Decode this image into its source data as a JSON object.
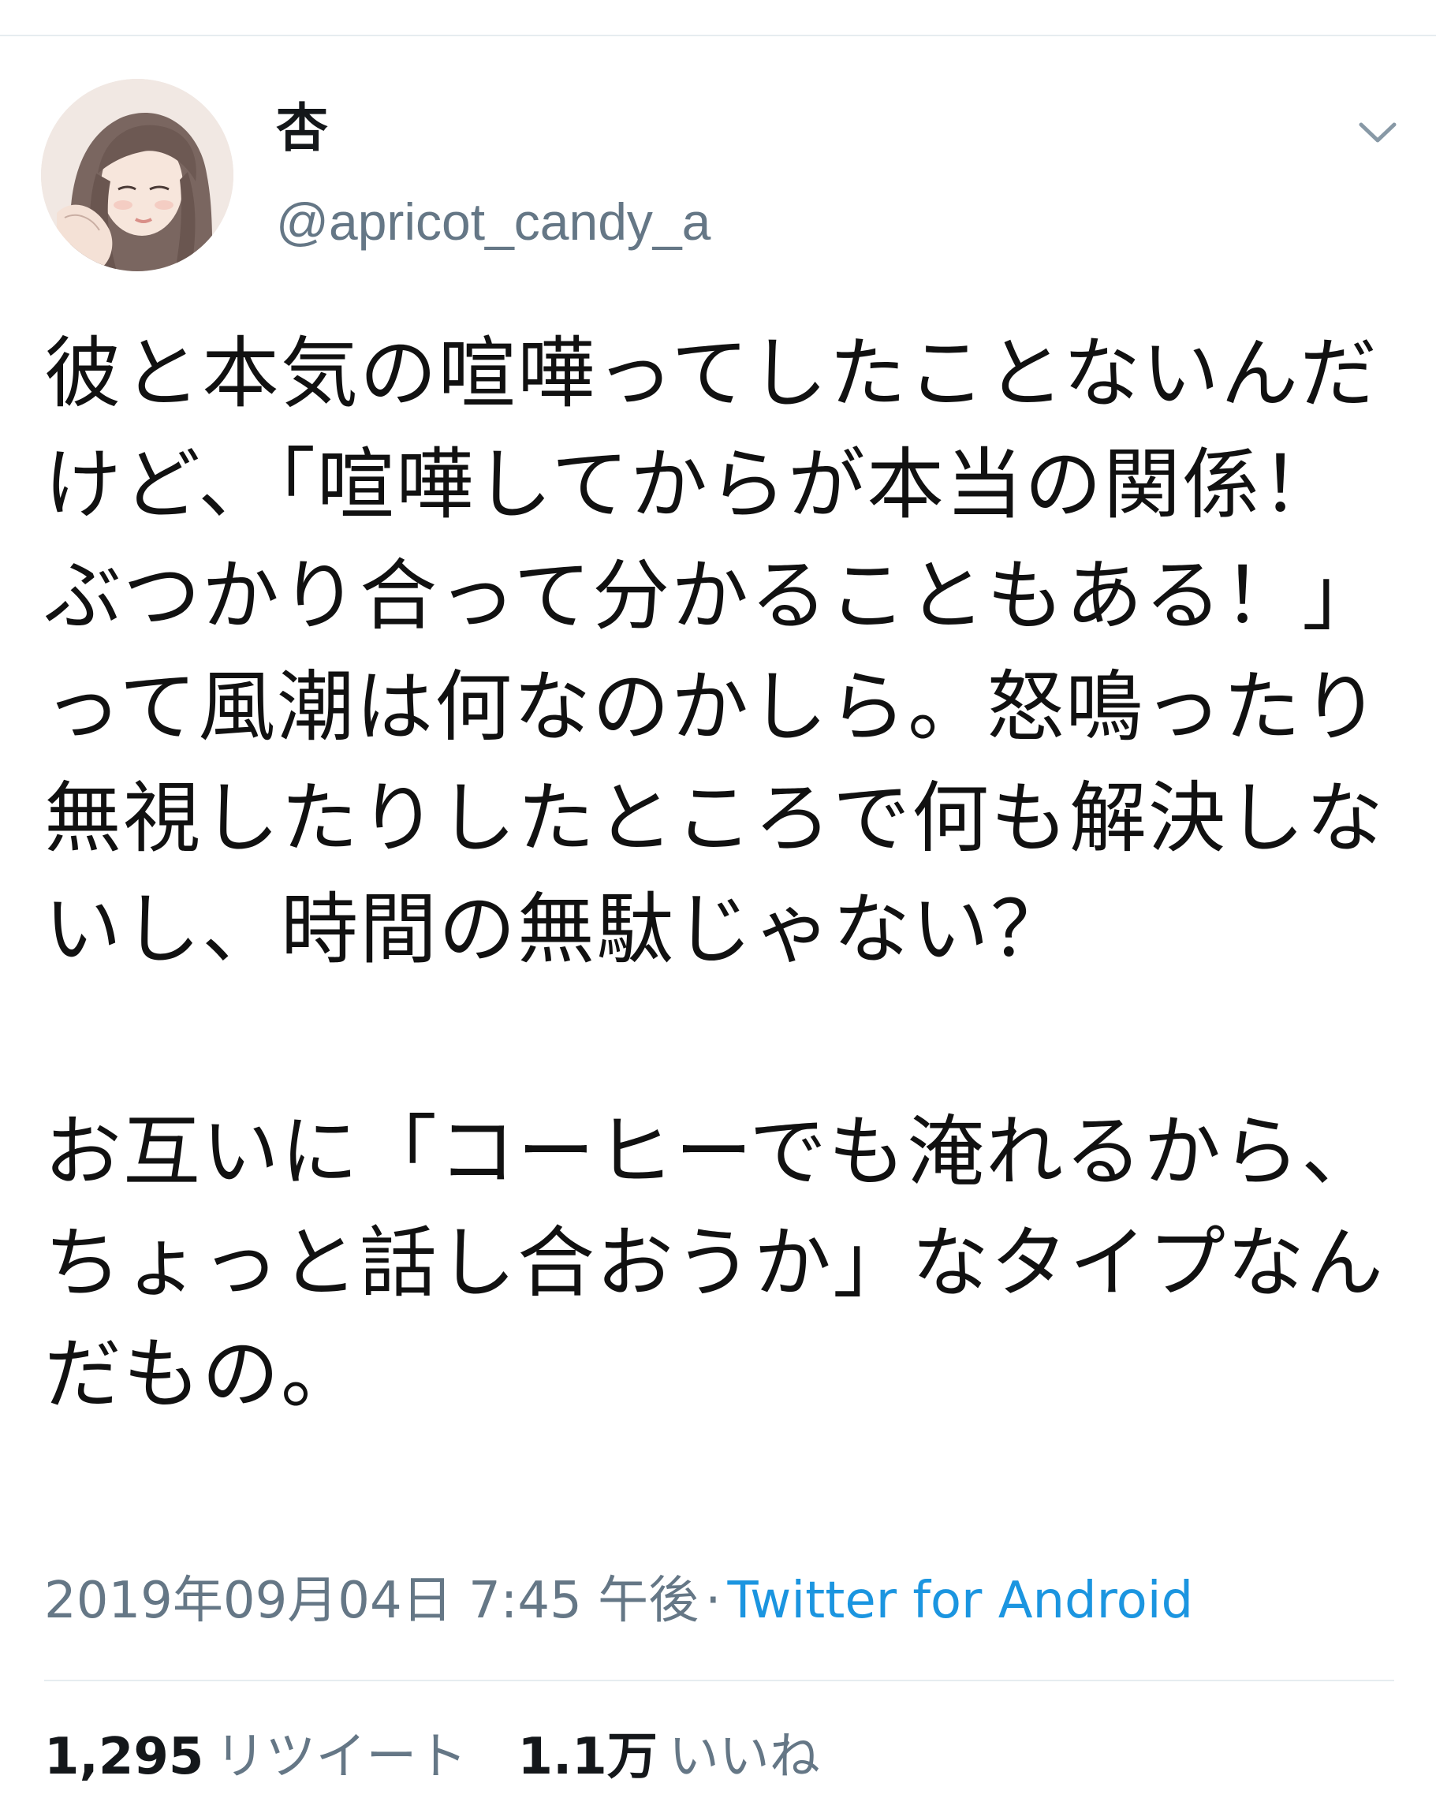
{
  "tweet": {
    "display_name": "杏",
    "handle": "@apricot_candy_a",
    "avatar_icon": "illustrated-woman-avatar",
    "menu_icon": "chevron-down-icon",
    "text": "彼と本気の喧嘩ってしたことないんだけど、「喧嘩してからが本当の関係！ぶつかり合って分かることもある！」って風潮は何なのかしら。怒鳴ったり無視したりしたところで何も解決しないし、時間の無駄じゃない？\n\nお互いに「コーヒーでも淹れるから、ちょっと話し合おうか」なタイプなんだもの。",
    "timestamp": "2019年09月04日 7:45 午後",
    "separator": "·",
    "source": "Twitter for Android"
  },
  "stats": {
    "retweets_count": "1,295",
    "retweets_label": "リツイート",
    "likes_count": "1.1万",
    "likes_label": "いいね"
  },
  "colors": {
    "text": "#14171a",
    "secondary": "#657786",
    "link": "#1b95e0",
    "divider": "#e6ecf0"
  }
}
